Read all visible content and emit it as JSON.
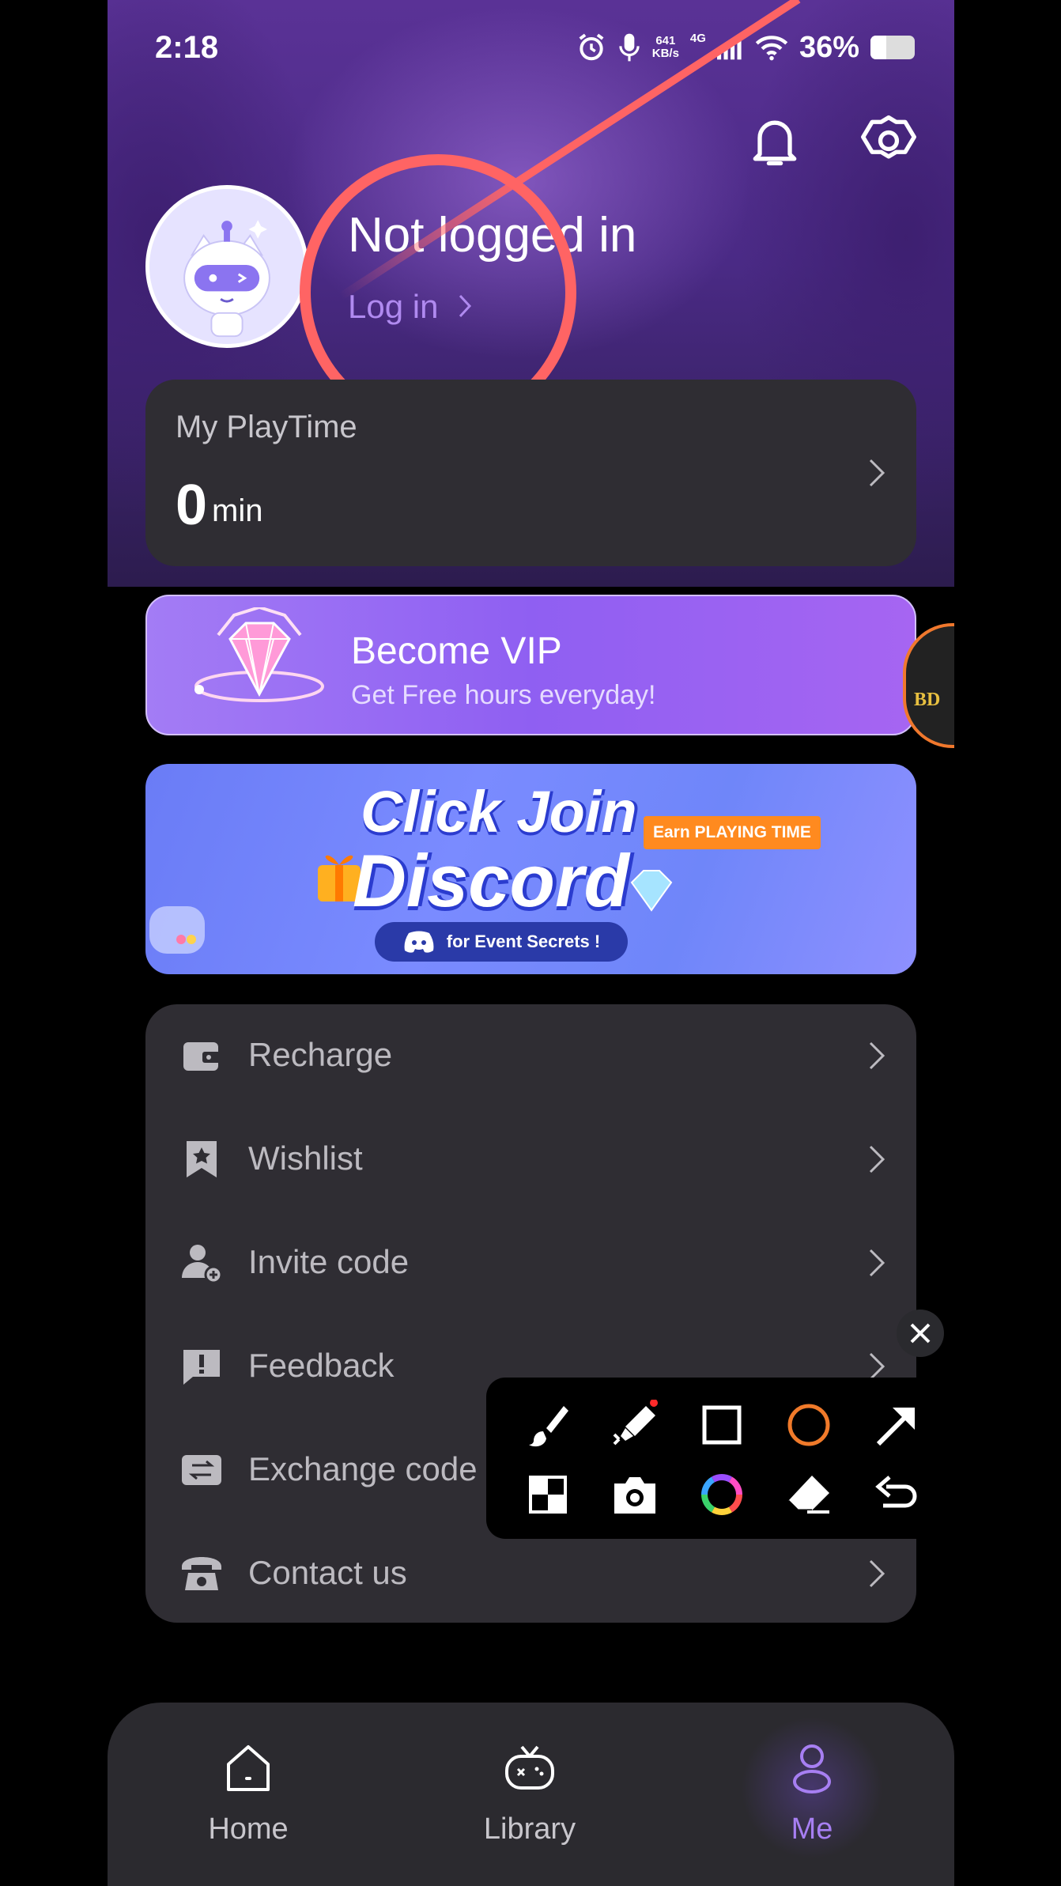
{
  "status_bar": {
    "time": "2:18",
    "speed_value": "641",
    "speed_unit": "KB/s",
    "network": "4G",
    "battery": "36%"
  },
  "header": {
    "notification_icon": "bell-icon",
    "settings_icon": "gear-icon"
  },
  "profile": {
    "title": "Not logged in",
    "login_label": "Log in",
    "avatar_icon": "robot-avatar"
  },
  "playtime": {
    "label": "My PlayTime",
    "value": "0",
    "unit": "min"
  },
  "vip": {
    "title": "Become VIP",
    "subtitle": "Get Free hours everyday!",
    "badge_text": "BD"
  },
  "discord_banner": {
    "line1": "Click Join",
    "line2": "Discord",
    "earn_tag": "Earn PLAYING TIME",
    "pill_text": "for Event Secrets !"
  },
  "menu": {
    "items": [
      {
        "label": "Recharge",
        "icon": "wallet-icon"
      },
      {
        "label": "Wishlist",
        "icon": "bookmark-star-icon"
      },
      {
        "label": "Invite code",
        "icon": "add-user-icon"
      },
      {
        "label": "Feedback",
        "icon": "feedback-icon"
      },
      {
        "label": "Exchange code",
        "icon": "exchange-icon"
      },
      {
        "label": "Contact us",
        "icon": "phone-icon"
      }
    ]
  },
  "annotation_toolbar": {
    "tools": [
      "brush-icon",
      "highlighter-icon",
      "rectangle-icon",
      "circle-icon",
      "arrow-icon",
      "mosaic-icon",
      "camera-icon",
      "color-wheel-icon",
      "eraser-icon",
      "undo-icon"
    ],
    "accent_circle_color": "#f07a2a"
  },
  "tabs": [
    {
      "label": "Home",
      "icon": "home-icon"
    },
    {
      "label": "Library",
      "icon": "gamepad-icon"
    },
    {
      "label": "Me",
      "icon": "person-icon",
      "active": true
    }
  ],
  "colors": {
    "accent": "#a77ff2",
    "annotation_red": "#ff6464",
    "card_bg": "#2f2d33"
  }
}
